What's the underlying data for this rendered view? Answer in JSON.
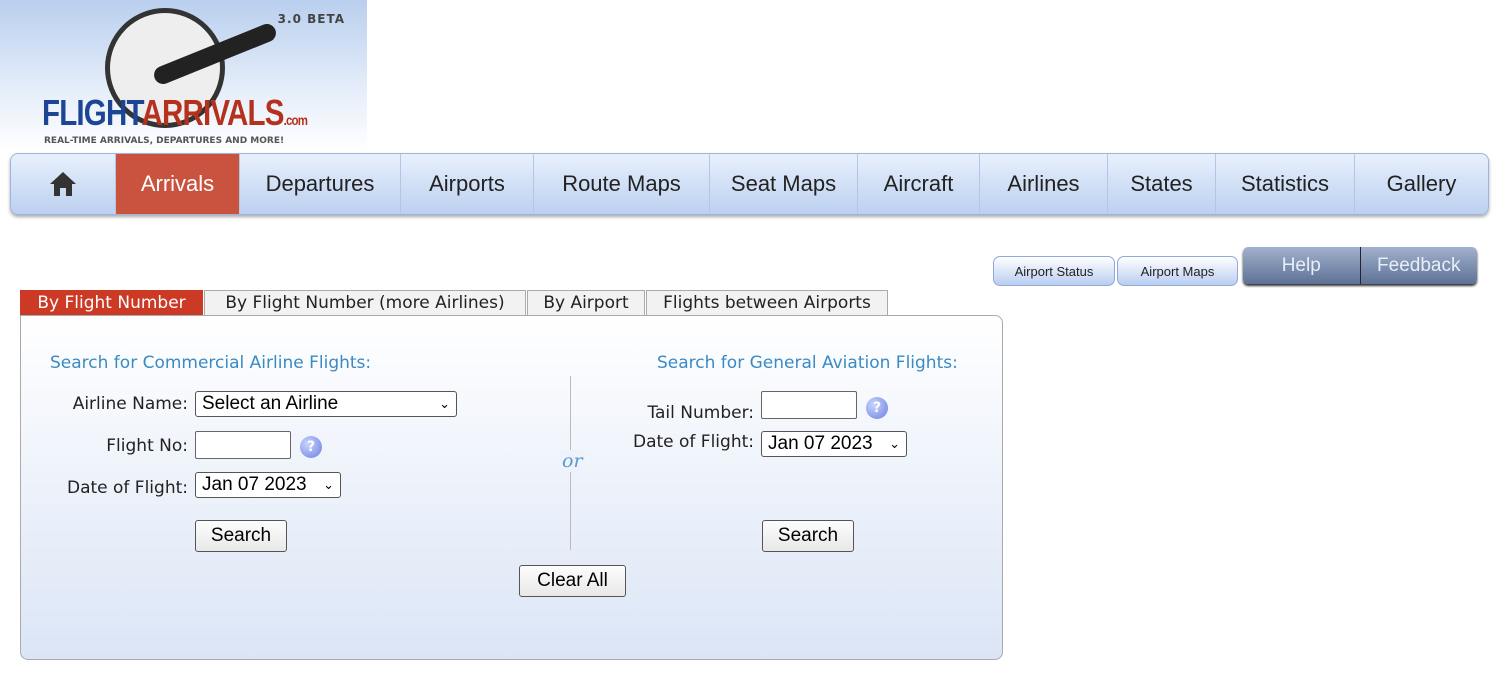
{
  "logo": {
    "brand_blue": "FLIGHT",
    "brand_red": "ARRIVALS",
    "tld": ".com",
    "version": "3.0 BETA",
    "tagline": "REAL-TIME ARRIVALS, DEPARTURES AND MORE!"
  },
  "nav": {
    "home_icon": "home-icon",
    "items": [
      "Arrivals",
      "Departures",
      "Airports",
      "Route Maps",
      "Seat Maps",
      "Aircraft",
      "Airlines",
      "States",
      "Statistics",
      "Gallery"
    ],
    "active": "Arrivals"
  },
  "secondary": {
    "airport_status": "Airport Status",
    "airport_maps": "Airport Maps",
    "help": "Help",
    "feedback": "Feedback"
  },
  "tabs": [
    "By Flight Number",
    "By Flight Number (more Airlines)",
    "By Airport",
    "Flights between Airports"
  ],
  "commercial": {
    "heading": "Search for Commercial Airline Flights:",
    "airline_label": "Airline Name:",
    "airline_value": "Select an Airline",
    "flight_label": "Flight No:",
    "flight_value": "",
    "date_label": "Date of Flight:",
    "date_value": "Jan 07 2023",
    "search": "Search"
  },
  "or": "or",
  "general": {
    "heading": "Search for General Aviation Flights:",
    "tail_label": "Tail Number:",
    "tail_value": "",
    "date_label": "Date of Flight:",
    "date_value": "Jan 07 2023",
    "search": "Search"
  },
  "clear_all": "Clear All",
  "colors": {
    "accent_red": "#cc3a25",
    "heading_blue": "#3a8ac4"
  }
}
